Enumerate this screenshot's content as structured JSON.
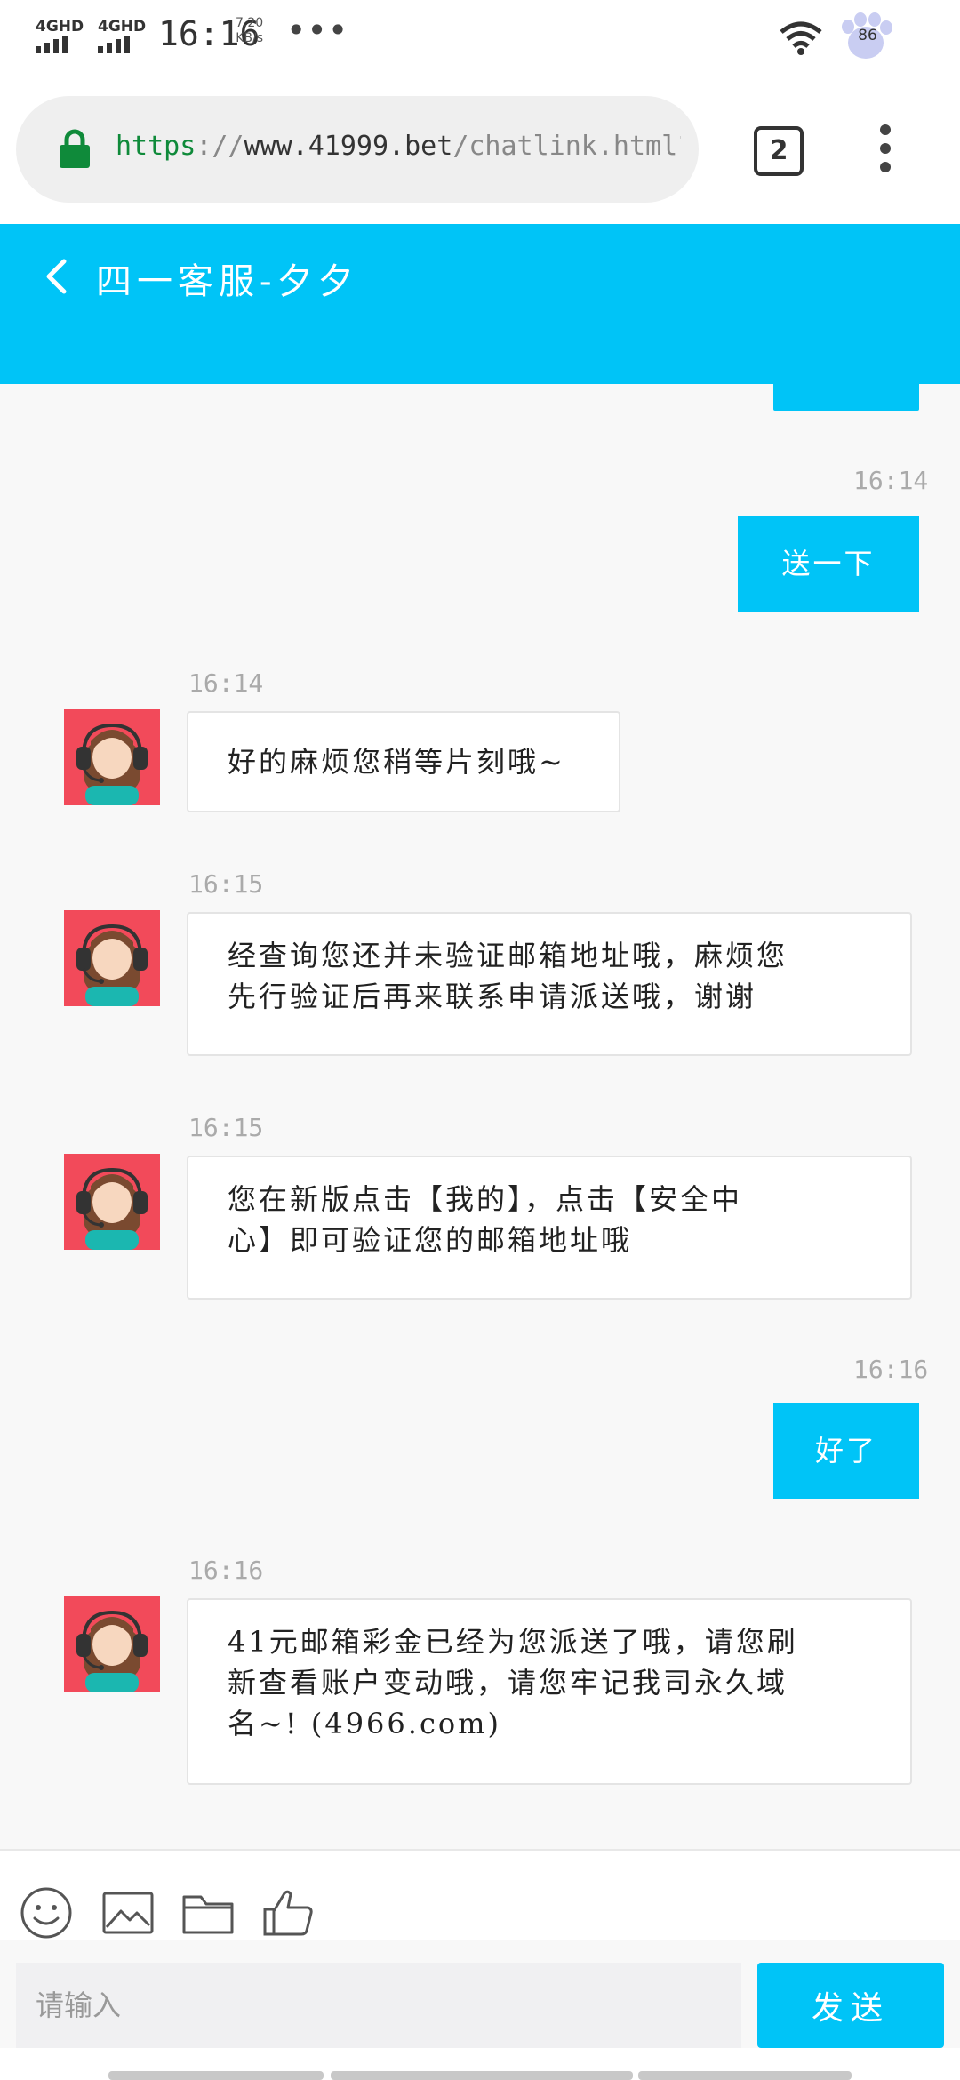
{
  "status_bar": {
    "network_1": "4GHD",
    "network_2": "4GHD",
    "time": "16:16",
    "speed_value": "7.20",
    "speed_unit": "KB/s",
    "overflow": "•••",
    "battery": "86"
  },
  "browser": {
    "url_scheme": "https",
    "url_sep": "://",
    "url_host": "www.41999.bet",
    "url_path": "/chatlink.html?uid=",
    "tab_count": "2"
  },
  "chat": {
    "title": "四一客服-夕夕",
    "messages": [
      {
        "from": "me",
        "time": "16:14",
        "text": "送一下"
      },
      {
        "from": "agent",
        "time": "16:14",
        "text": "好的麻烦您稍等片刻哦~"
      },
      {
        "from": "agent",
        "time": "16:15",
        "lines": [
          "经查询您还并未验证邮箱地址哦，麻烦您",
          "先行验证后再来联系申请派送哦，谢谢"
        ]
      },
      {
        "from": "agent",
        "time": "16:15",
        "lines": [
          "您在新版点击【我的】，点击【安全中",
          "心】即可验证您的邮箱地址哦"
        ]
      },
      {
        "from": "me",
        "time": "16:16",
        "text": "好了"
      },
      {
        "from": "agent",
        "time": "16:16",
        "lines": [
          "41元邮箱彩金已经为您派送了哦，请您刷",
          "新查看账户变动哦，请您牢记我司永久域",
          "名~!  (4966.com)"
        ]
      }
    ]
  },
  "composer": {
    "tools": [
      "emoji-icon",
      "image-icon",
      "folder-icon",
      "thumbs-up-icon"
    ],
    "input_placeholder": "请输入",
    "send_label": "发送"
  },
  "colors": {
    "accent": "#00c4f7",
    "avatar_bg": "#f24a5a",
    "lock": "#0f8a3a"
  }
}
